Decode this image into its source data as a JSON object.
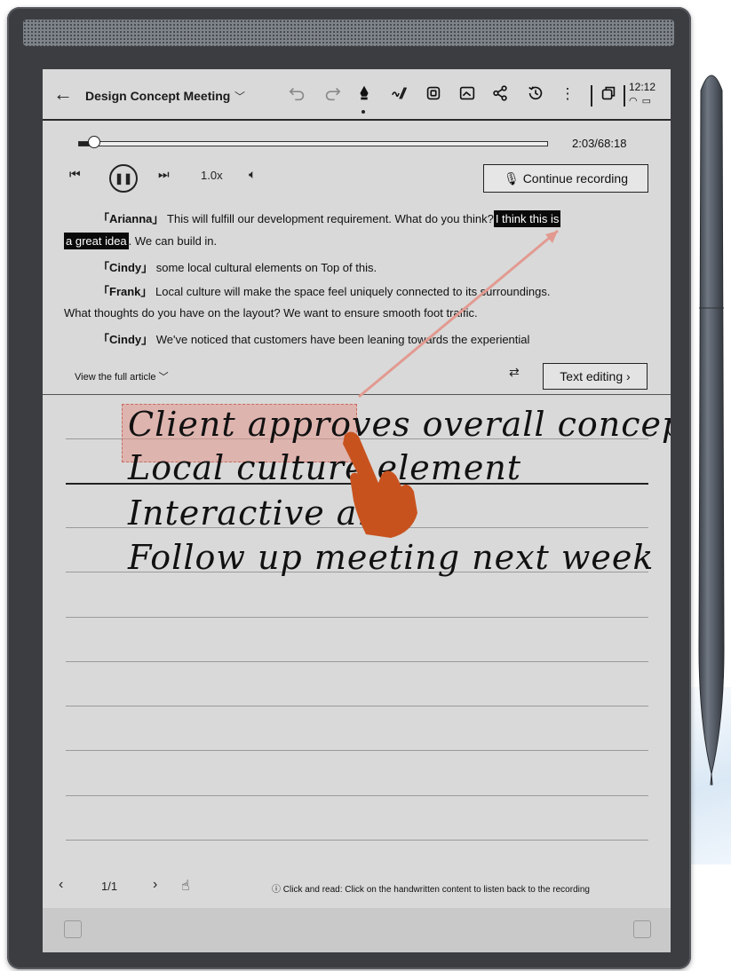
{
  "header": {
    "title": "Design Concept Meeting",
    "clock": "12:12"
  },
  "player": {
    "progress_fraction": 0.0299,
    "time": "2:03/68:18",
    "speed": "1.0x",
    "continue_recording": "Continue recording"
  },
  "transcript": {
    "lines": [
      {
        "speaker": "「Arianna」",
        "text": "This will fulfill our development requirement. What do you think?",
        "highlight": "I think this is"
      },
      {
        "highlight": "a great idea",
        "text": ". We can build in."
      },
      {
        "speaker": "「Cindy」",
        "text": "some local cultural elements on Top of this."
      },
      {
        "speaker": "「Frank」",
        "text": "Local culture will make the space feel uniquely connected to its surroundings."
      },
      {
        "text": "What thoughts do you have on the layout? We want to ensure smooth foot traffic."
      },
      {
        "speaker": "「Cindy」",
        "text": "We've noticed that customers have been leaning towards the experiential"
      }
    ],
    "view_full": "View the full article",
    "text_editing": "Text editing"
  },
  "notes": {
    "lines": [
      "Client approves overall concept",
      "Local culture element",
      "Interactive art",
      "Follow up meeting next week"
    ]
  },
  "footer": {
    "page": "1/1",
    "hint": "Click and read: Click on the handwritten content to listen back to the recording"
  },
  "colors": {
    "screen": "#d9d9d9",
    "selection": "#e2968c",
    "hand_pointer": "#c8521e",
    "highlight": "#0a0a0a"
  }
}
